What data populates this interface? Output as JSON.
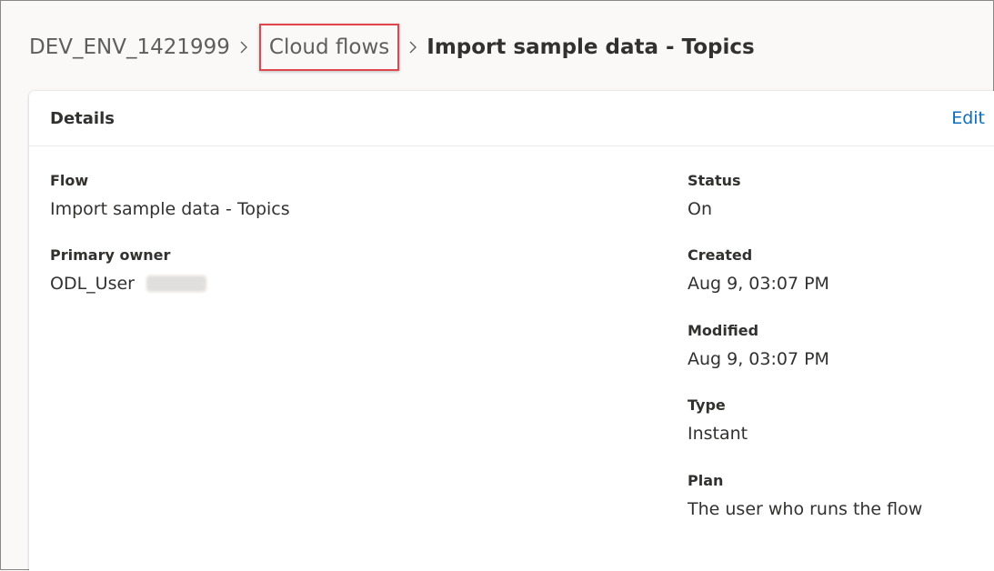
{
  "breadcrumb": {
    "environment": "DEV_ENV_1421999",
    "section": "Cloud flows",
    "current": "Import sample data - Topics"
  },
  "card": {
    "title": "Details",
    "edit_label": "Edit"
  },
  "fields": {
    "flow": {
      "label": "Flow",
      "value": "Import sample data - Topics"
    },
    "primary_owner": {
      "label": "Primary owner",
      "value": "ODL_User"
    },
    "status": {
      "label": "Status",
      "value": "On"
    },
    "created": {
      "label": "Created",
      "value": "Aug 9, 03:07 PM"
    },
    "modified": {
      "label": "Modified",
      "value": "Aug 9, 03:07 PM"
    },
    "type": {
      "label": "Type",
      "value": "Instant"
    },
    "plan": {
      "label": "Plan",
      "value": "The user who runs the flow"
    }
  },
  "icons": {
    "separator": "chevron-right-icon"
  },
  "colors": {
    "link": "#0f6cbd",
    "highlight": "#e0464e"
  }
}
